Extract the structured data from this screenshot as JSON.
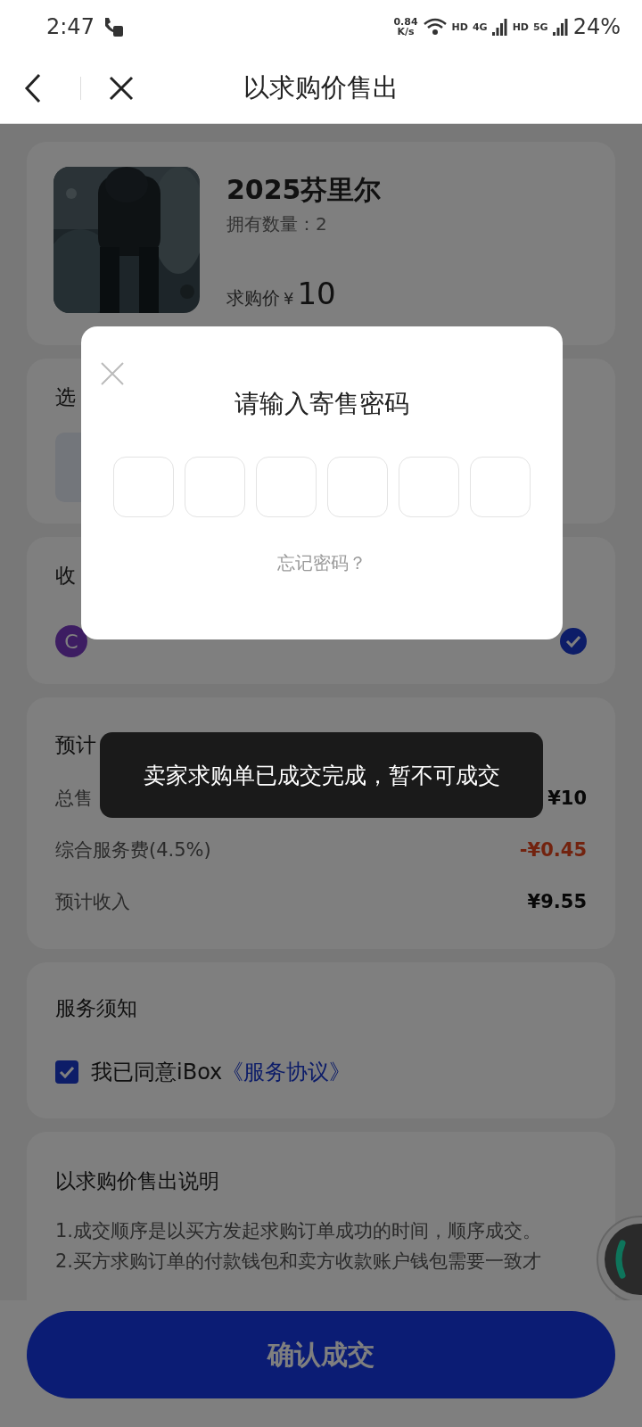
{
  "status_bar": {
    "time": "2:47",
    "speed_value": "0.84",
    "speed_unit": "K/s",
    "hd_1": "HD",
    "network_1": "4G",
    "hd_2": "HD",
    "network_2": "5G",
    "battery": "24%"
  },
  "header": {
    "title": "以求购价售出"
  },
  "product": {
    "name": "2025芬里尔",
    "owned": "拥有数量：2",
    "price_label": "求购价",
    "currency": "¥",
    "price": "10"
  },
  "wallet_section": {
    "title": "选"
  },
  "receive_section": {
    "title": "收",
    "avatar": "C",
    "checked": true
  },
  "income": {
    "title": "预计",
    "rows": [
      {
        "label": "总售",
        "value": "¥10",
        "kind": "normal"
      },
      {
        "label": "综合服务费(4.5%)",
        "value": "-¥0.45",
        "kind": "deduction"
      },
      {
        "label": "预计收入",
        "value": "¥9.55",
        "kind": "normal"
      }
    ]
  },
  "service": {
    "title": "服务须知",
    "agreed": true,
    "text": "我已同意iBox",
    "link": "《服务协议》"
  },
  "notes": {
    "title": "以求购价售出说明",
    "lines": [
      "1.成交顺序是以买方发起求购订单成功的时间，顺序成交。",
      "2.买方求购订单的付款钱包和卖方收款账户钱包需要一致才"
    ]
  },
  "confirm_button": {
    "label": "确认成交"
  },
  "dialog": {
    "title": "请输入寄售密码",
    "code_boxes": [
      {
        "filled": false
      },
      {
        "filled": false
      },
      {
        "filled": false
      },
      {
        "filled": false
      },
      {
        "filled": false
      },
      {
        "filled": false
      }
    ],
    "forgot_link": "忘记密码？"
  },
  "toast": {
    "text": "卖家求购单已成交完成，暂不可成交"
  }
}
